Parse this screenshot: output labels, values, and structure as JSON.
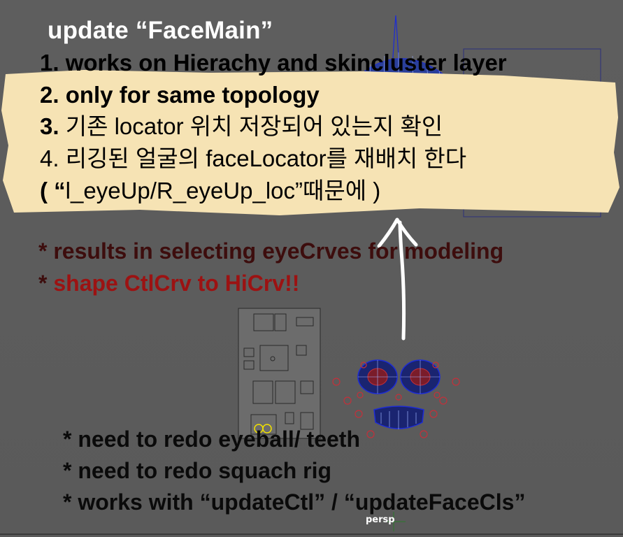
{
  "viewport": {
    "camera_label": "persp"
  },
  "notes": {
    "title": "update “FaceMain”",
    "steps": [
      {
        "num": "1.",
        "text": "works on Hierachy and skincluster layer"
      },
      {
        "num": "2.",
        "text": "only for same topology"
      },
      {
        "num": "3.",
        "text": "기존 locator 위치 저장되어 있는지 확인"
      },
      {
        "num": "4.",
        "text": "리깅된 얼굴의 faceLocator를 재배치 한다"
      },
      {
        "open": "( “",
        "text": "l_eyeUp/R_eyeUp_loc”때문에 )"
      }
    ],
    "results": [
      {
        "star": "*",
        "text": "results in selecting eyeCrves for modeling"
      },
      {
        "star": "*",
        "text": "shape CtlCrv to HiCrv!!"
      }
    ],
    "todos": [
      "* need to redo eyeball/ teeth",
      "* need to redo squach rig",
      "* works with “updateCtl” / “updateFaceCls”"
    ]
  },
  "colors": {
    "viewport_bg": "#5c5c5c",
    "highlight": "#f6e3b4",
    "title_text": "#ffffff",
    "dark_red": "#3d0d0d",
    "red": "#9c1212",
    "wire_blue": "#1c2bd6",
    "wire_red": "#c3303a",
    "chalk_arrow": "#ffffff"
  },
  "icons": {
    "arrow": "hand-drawn-up-arrow-icon",
    "axis": "view-axis-icon"
  }
}
